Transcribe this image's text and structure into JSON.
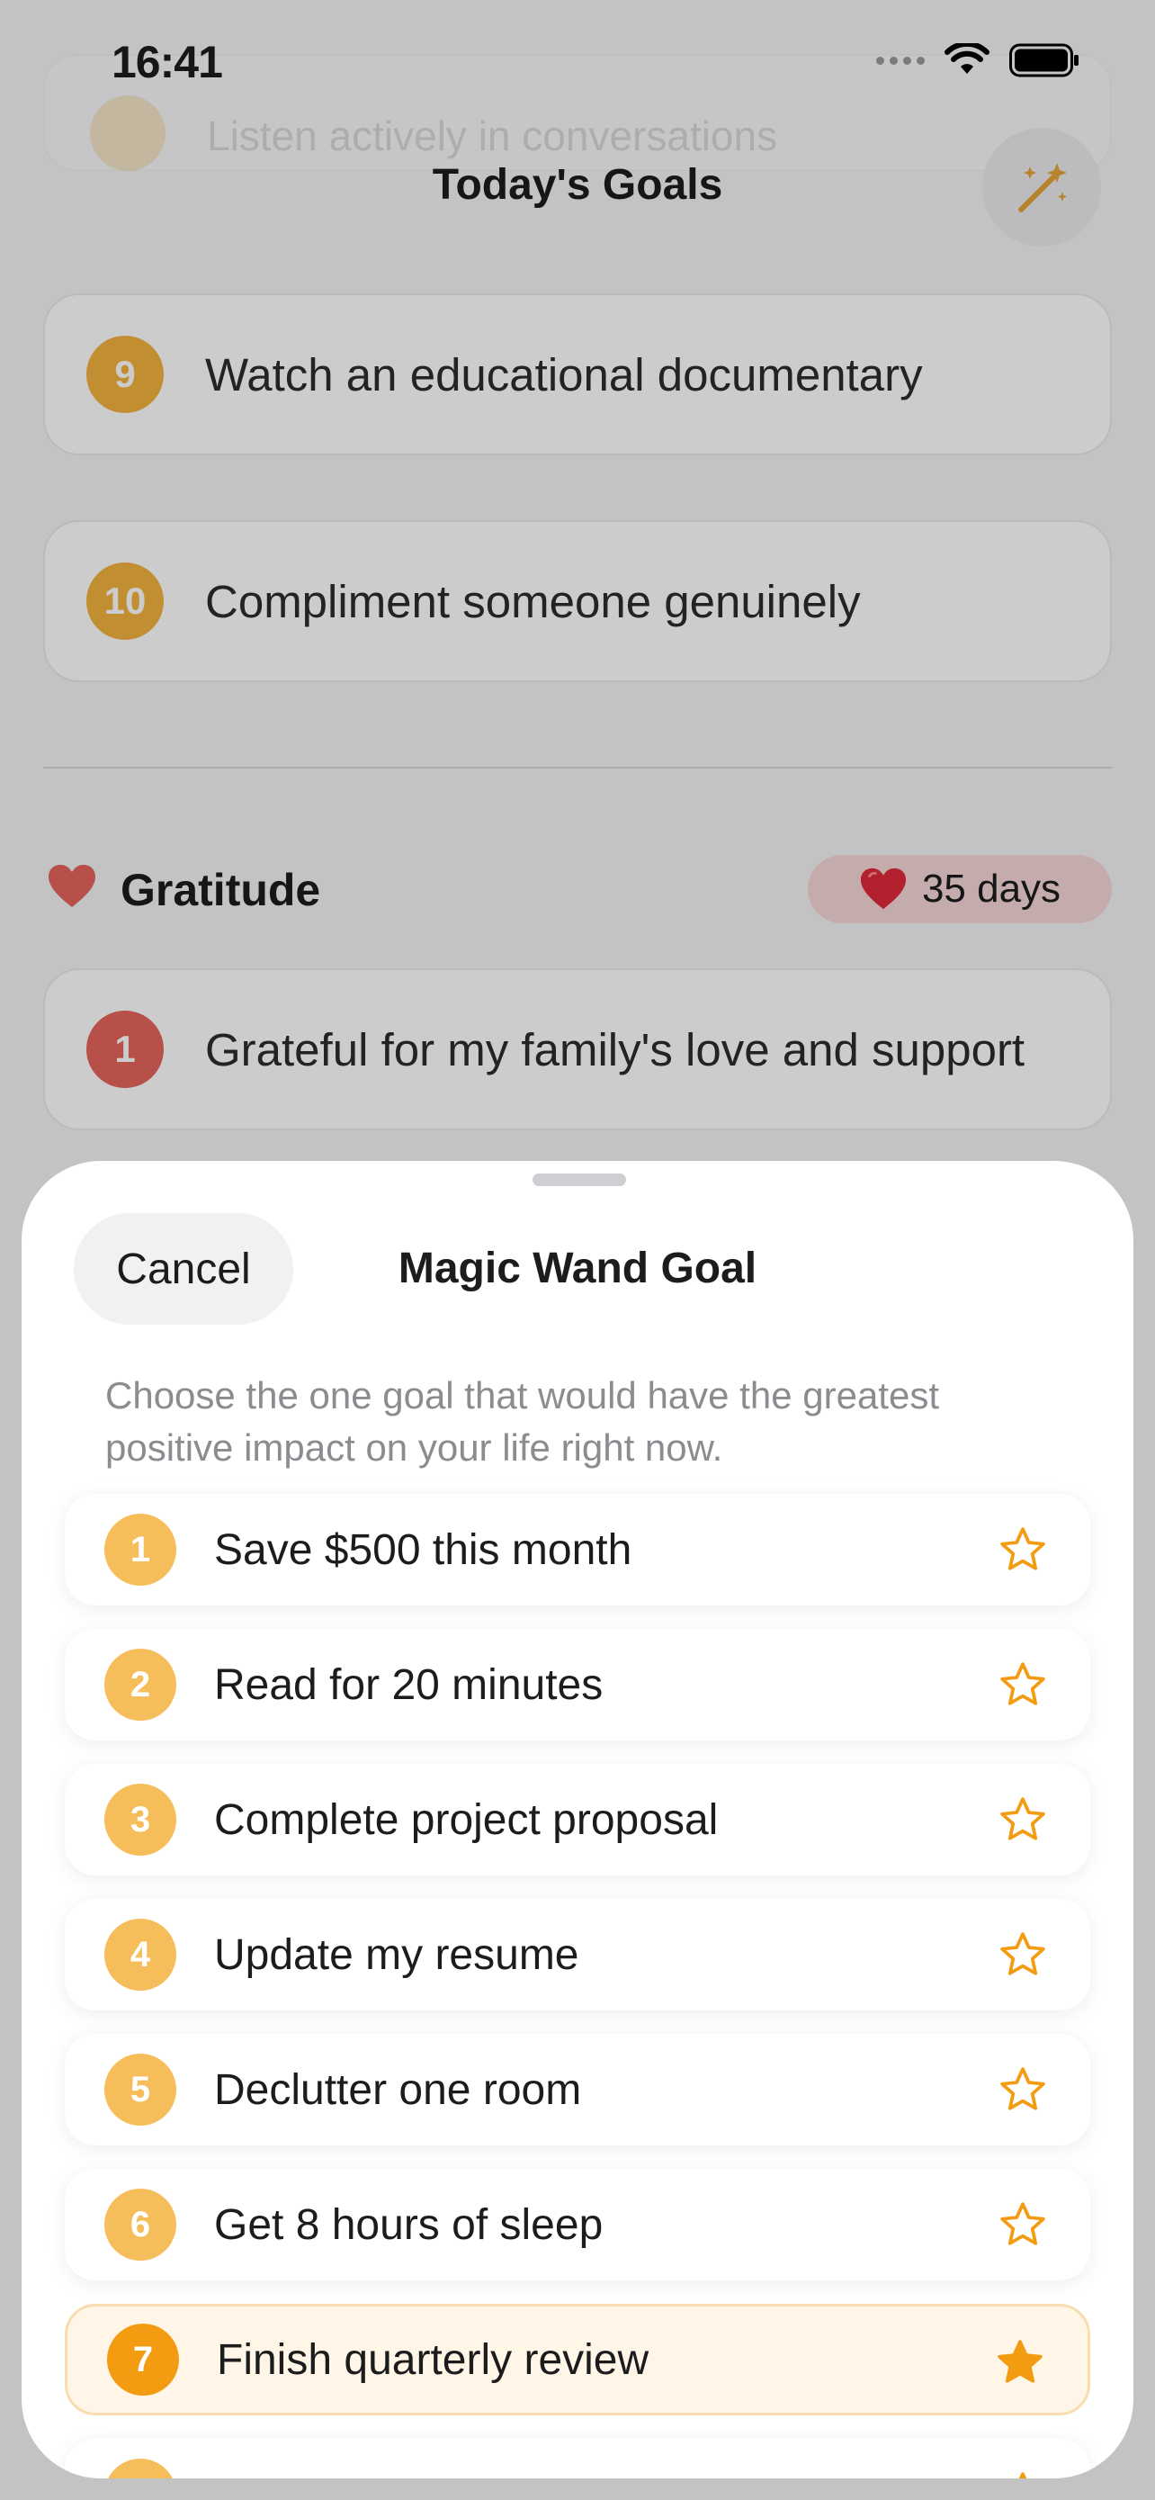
{
  "status_bar": {
    "time": "16:41"
  },
  "background": {
    "faded_goal": {
      "text": "Listen actively in conversations"
    },
    "nav_title": "Today's Goals",
    "goals": [
      {
        "number": "9",
        "text": "Watch an educational documentary"
      },
      {
        "number": "10",
        "text": "Compliment someone genuinely"
      }
    ],
    "gratitude": {
      "title": "Gratitude",
      "streak": "35 days",
      "items": [
        {
          "number": "1",
          "text": "Grateful for my family's love and support"
        }
      ]
    }
  },
  "sheet": {
    "cancel_label": "Cancel",
    "title": "Magic Wand Goal",
    "description": "Choose the one goal that would have the greatest positive impact on your life right now.",
    "options": [
      {
        "number": "1",
        "text": "Save $500 this month",
        "selected": false
      },
      {
        "number": "2",
        "text": "Read for 20 minutes",
        "selected": false
      },
      {
        "number": "3",
        "text": "Complete project proposal",
        "selected": false
      },
      {
        "number": "4",
        "text": "Update my resume",
        "selected": false
      },
      {
        "number": "5",
        "text": "Declutter one room",
        "selected": false
      },
      {
        "number": "6",
        "text": "Get 8 hours of sleep",
        "selected": false
      },
      {
        "number": "7",
        "text": "Finish quarterly review",
        "selected": true
      }
    ]
  },
  "colors": {
    "accent": "#F39C12",
    "goal_badge": "#F2B23E",
    "gratitude_badge": "#E4645A"
  },
  "icons": {
    "wand": "magic-wand-icon",
    "heart": "heart-icon",
    "star_outline": "star-outline-icon",
    "star_filled": "star-filled-icon"
  }
}
